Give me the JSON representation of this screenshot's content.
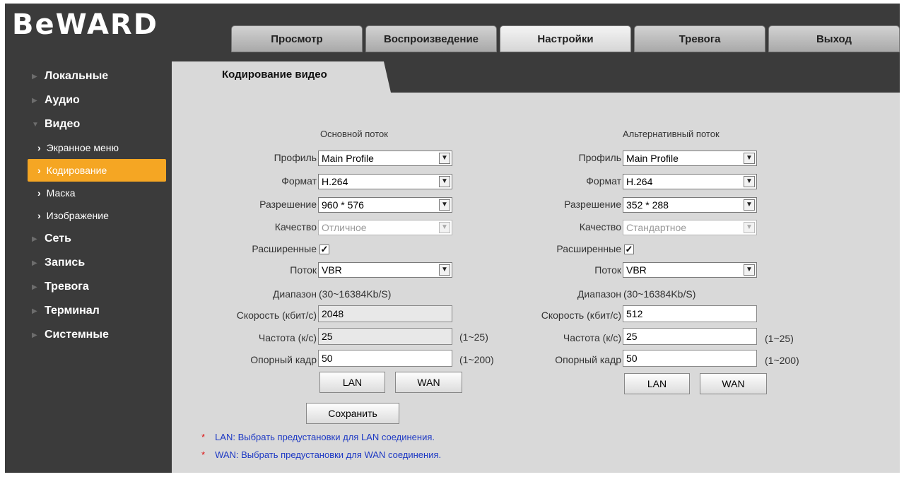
{
  "brand": {
    "logo": "BeWARD"
  },
  "nav": {
    "tabs": [
      "Просмотр",
      "Воспроизведение",
      "Настройки",
      "Тревога",
      "Выход"
    ],
    "active": 2
  },
  "sidebar": {
    "lokalnye": "Локальные",
    "audio": "Аудио",
    "video": "Видео",
    "video_sub": [
      "Экранное меню",
      "Кодирование",
      "Маска",
      "Изображение"
    ],
    "set": "Сеть",
    "zapis": "Запись",
    "trevoga": "Тревога",
    "terminal": "Терминал",
    "sistemnye": "Системные"
  },
  "page": {
    "title": "Кодирование видео"
  },
  "labels": {
    "profile": "Профиль",
    "format": "Формат",
    "resolution": "Разрешение",
    "quality": "Качество",
    "advanced": "Расширенные",
    "stream": "Поток",
    "range": "Диапазон",
    "bitrate": "Скорость (кбит/с)",
    "framerate": "Частота (к/с)",
    "keyframe": "Опорный кадр"
  },
  "main": {
    "heading": "Основной поток",
    "profile": "Main Profile",
    "format": "H.264",
    "resolution": "960 * 576",
    "quality": "Отличное",
    "advanced_checked": "✓",
    "stream": "VBR",
    "range": "(30~16384Kb/S)",
    "bitrate": "2048",
    "framerate": "25",
    "framerate_range": "(1~25)",
    "keyframe": "50",
    "keyframe_range": "(1~200)",
    "lan": "LAN",
    "wan": "WAN"
  },
  "alt": {
    "heading": "Альтернативный поток",
    "profile": "Main Profile",
    "format": "H.264",
    "resolution": "352 * 288",
    "quality": "Стандартное",
    "advanced_checked": "✓",
    "stream": "VBR",
    "range": "(30~16384Kb/S)",
    "bitrate": "512",
    "framerate": "25",
    "framerate_range": "(1~25)",
    "keyframe": "50",
    "keyframe_range": "(1~200)",
    "lan": "LAN",
    "wan": "WAN"
  },
  "save": "Сохранить",
  "notes": {
    "star": "*",
    "lan": "LAN: Выбрать предустановки для LAN соединения.",
    "wan": "WAN: Выбрать предустановки для WAN соединения."
  },
  "icons": {
    "dropdown": "▼",
    "sidebar_collapsed": "▶",
    "sidebar_expanded": "▼",
    "submenu_chevron": "›"
  }
}
